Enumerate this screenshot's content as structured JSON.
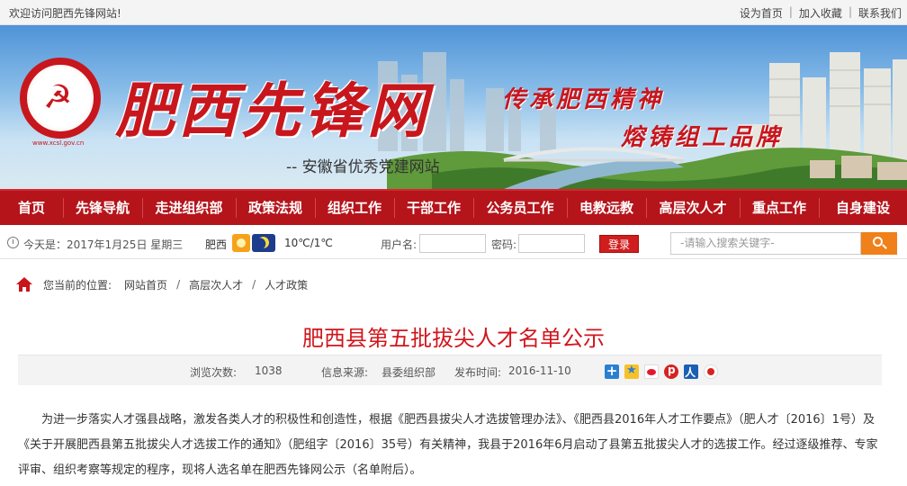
{
  "topbar": {
    "welcome": "欢迎访问肥西先锋网站!",
    "links": [
      "设为首页",
      "加入收藏",
      "联系我们"
    ]
  },
  "banner": {
    "logo_emblem": "☭",
    "logo_url": "www.xcsl.gov.cn",
    "site_name": "肥西先锋网",
    "subtitle": "-- 安徽省优秀党建网站",
    "slogan_1": "传承肥西精神",
    "slogan_2": "熔铸组工品牌"
  },
  "nav": {
    "items": [
      "首页",
      "先锋导航",
      "走进组织部",
      "政策法规",
      "组织工作",
      "干部工作",
      "公务员工作",
      "电教远教",
      "高层次人才",
      "重点工作",
      "自身建设"
    ]
  },
  "infobar": {
    "date": "今天是：2017年1月25日 星期三",
    "city": "肥西",
    "temperature": "10℃/1℃",
    "username_label": "用户名:",
    "password_label": "密码:",
    "login_label": "登录",
    "search_placeholder": "-请输入搜索关键字-"
  },
  "breadcrumb": {
    "prefix": "您当前的位置:",
    "items": [
      "网站首页",
      "高层次人才",
      "人才政策"
    ]
  },
  "article": {
    "title": "肥西县第五批拔尖人才名单公示",
    "views_label": "浏览次数:",
    "views": "1038",
    "source_label": "信息来源:",
    "source": "县委组织部",
    "date_label": "发布时间:",
    "date": "2016-11-10",
    "share_icons": [
      "plus-icon",
      "qzone-icon",
      "weibo-icon",
      "pinterest-icon",
      "renren-icon",
      "other-share-icon"
    ],
    "paragraph": "为进一步落实人才强县战略，激发各类人才的积极性和创造性，根据《肥西县拔尖人才选拔管理办法》、《肥西县2016年人才工作要点》（肥人才〔2016〕1号）及《关于开展肥西县第五批拔尖人才选拔工作的通知》（肥组字〔2016〕35号）有关精神，我县于2016年6月启动了县第五批拔尖人才的选拔工作。经过逐级推荐、专家评审、组织考察等规定的程序，现将人选名单在肥西先锋网公示（名单附后）。"
  },
  "colors": {
    "brand_red": "#b5141b",
    "title_red": "#d0161d",
    "search_orange": "#f08019"
  }
}
